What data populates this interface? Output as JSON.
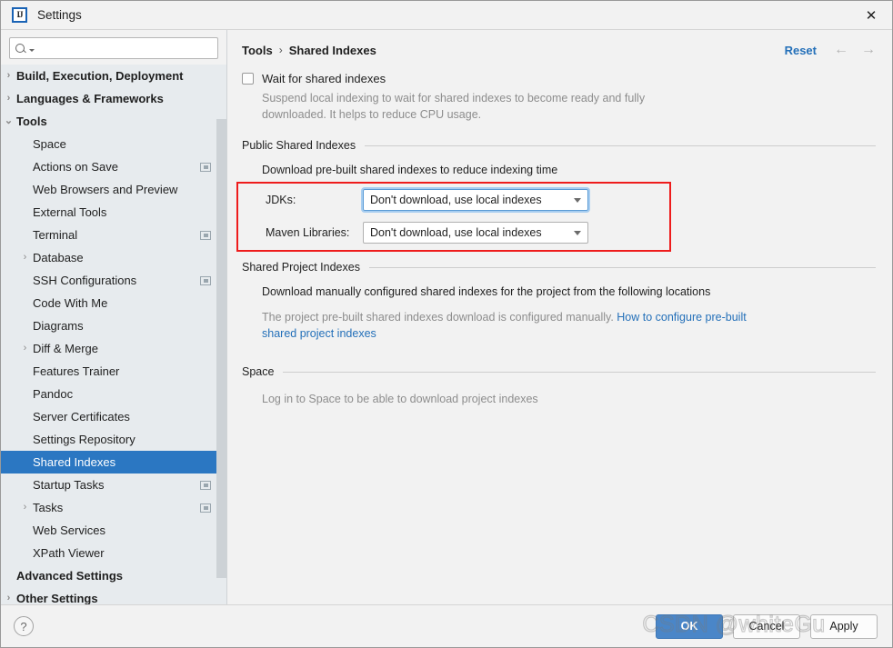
{
  "window": {
    "title": "Settings",
    "logo_text": "IJ",
    "close_icon": "✕"
  },
  "search": {
    "value": "",
    "placeholder": ""
  },
  "sidebar": {
    "items": [
      {
        "label": "Build, Execution, Deployment",
        "twisty": "›",
        "indent": 0,
        "bold": true,
        "badge": false,
        "selected": false
      },
      {
        "label": "Languages & Frameworks",
        "twisty": "›",
        "indent": 0,
        "bold": true,
        "badge": false,
        "selected": false
      },
      {
        "label": "Tools",
        "twisty": "⌄",
        "indent": 0,
        "bold": true,
        "badge": false,
        "selected": false
      },
      {
        "label": "Space",
        "twisty": "",
        "indent": 1,
        "bold": false,
        "badge": false,
        "selected": false
      },
      {
        "label": "Actions on Save",
        "twisty": "",
        "indent": 1,
        "bold": false,
        "badge": true,
        "selected": false
      },
      {
        "label": "Web Browsers and Preview",
        "twisty": "",
        "indent": 1,
        "bold": false,
        "badge": false,
        "selected": false
      },
      {
        "label": "External Tools",
        "twisty": "",
        "indent": 1,
        "bold": false,
        "badge": false,
        "selected": false
      },
      {
        "label": "Terminal",
        "twisty": "",
        "indent": 1,
        "bold": false,
        "badge": true,
        "selected": false
      },
      {
        "label": "Database",
        "twisty": "›",
        "indent": 1,
        "bold": false,
        "badge": false,
        "selected": false
      },
      {
        "label": "SSH Configurations",
        "twisty": "",
        "indent": 1,
        "bold": false,
        "badge": true,
        "selected": false
      },
      {
        "label": "Code With Me",
        "twisty": "",
        "indent": 1,
        "bold": false,
        "badge": false,
        "selected": false
      },
      {
        "label": "Diagrams",
        "twisty": "",
        "indent": 1,
        "bold": false,
        "badge": false,
        "selected": false
      },
      {
        "label": "Diff & Merge",
        "twisty": "›",
        "indent": 1,
        "bold": false,
        "badge": false,
        "selected": false
      },
      {
        "label": "Features Trainer",
        "twisty": "",
        "indent": 1,
        "bold": false,
        "badge": false,
        "selected": false
      },
      {
        "label": "Pandoc",
        "twisty": "",
        "indent": 1,
        "bold": false,
        "badge": false,
        "selected": false
      },
      {
        "label": "Server Certificates",
        "twisty": "",
        "indent": 1,
        "bold": false,
        "badge": false,
        "selected": false
      },
      {
        "label": "Settings Repository",
        "twisty": "",
        "indent": 1,
        "bold": false,
        "badge": false,
        "selected": false
      },
      {
        "label": "Shared Indexes",
        "twisty": "",
        "indent": 1,
        "bold": false,
        "badge": false,
        "selected": true
      },
      {
        "label": "Startup Tasks",
        "twisty": "",
        "indent": 1,
        "bold": false,
        "badge": true,
        "selected": false
      },
      {
        "label": "Tasks",
        "twisty": "›",
        "indent": 1,
        "bold": false,
        "badge": true,
        "selected": false
      },
      {
        "label": "Web Services",
        "twisty": "",
        "indent": 1,
        "bold": false,
        "badge": false,
        "selected": false
      },
      {
        "label": "XPath Viewer",
        "twisty": "",
        "indent": 1,
        "bold": false,
        "badge": false,
        "selected": false
      },
      {
        "label": "Advanced Settings",
        "twisty": "",
        "indent": 0,
        "bold": true,
        "badge": false,
        "selected": false
      },
      {
        "label": "Other Settings",
        "twisty": "›",
        "indent": 0,
        "bold": true,
        "badge": false,
        "selected": false
      }
    ]
  },
  "main": {
    "breadcrumb": {
      "root": "Tools",
      "separator": "›",
      "current": "Shared Indexes"
    },
    "reset_label": "Reset",
    "nav_back_icon": "←",
    "nav_forward_icon": "→",
    "wait_checkbox": {
      "label": "Wait for shared indexes",
      "checked": false,
      "hint": "Suspend local indexing to wait for shared indexes to become ready and fully downloaded. It helps to reduce CPU usage."
    },
    "public_section": {
      "title": "Public Shared Indexes",
      "description": "Download pre-built shared indexes to reduce indexing time",
      "rows": [
        {
          "label": "JDKs:",
          "value": "Don't download, use local indexes",
          "focused": true
        },
        {
          "label": "Maven Libraries:",
          "value": "Don't download, use local indexes",
          "focused": false
        }
      ]
    },
    "project_section": {
      "title": "Shared Project Indexes",
      "description": "Download manually configured shared indexes for the project from the following locations",
      "note_prefix": "The project pre-built shared indexes download is configured manually. ",
      "note_link": "How to configure pre-built shared project indexes"
    },
    "space_section": {
      "title": "Space",
      "description": "Log in to Space to be able to download project indexes"
    }
  },
  "footer": {
    "help_icon": "?",
    "ok_label": "OK",
    "cancel_label": "Cancel",
    "apply_label": "Apply"
  },
  "watermark": {
    "text": "CSDN @whiteGu"
  },
  "colors": {
    "selection_blue": "#2b77c2",
    "link_blue": "#2470b9",
    "primary_button": "#4a86c8",
    "annotation_red": "#ee1c1c",
    "sidebar_bg": "#e7ebee",
    "panel_bg": "#f2f2f2"
  }
}
